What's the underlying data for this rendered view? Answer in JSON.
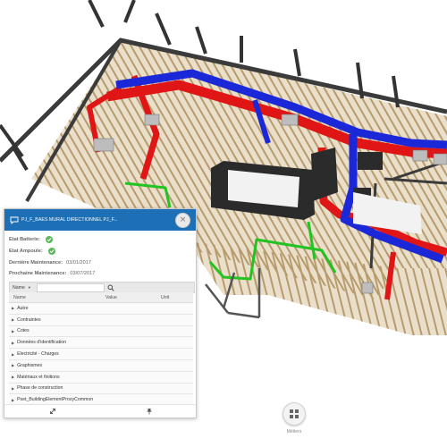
{
  "panel": {
    "title": "PJ_F_BAES MURAL DIRECTIONNEL PJ_F...",
    "rows": [
      {
        "label": "Etat Batterie:",
        "type": "check"
      },
      {
        "label": "Etat Ampoule:",
        "type": "check"
      },
      {
        "label": "Dernière Maintenance:",
        "value": "03/01/2017"
      },
      {
        "label": "Prochaine Maintenance:",
        "value": "03/07/2017"
      }
    ],
    "filter": {
      "select_label": "Name"
    },
    "columns": {
      "name": "Name",
      "value": "Value",
      "unit": "Unit"
    },
    "groups": [
      "Autre",
      "Contraintes",
      "Cotes",
      "Données d'identification",
      "Electricité - Charges",
      "Graphismes",
      "Matériaux et finitions",
      "Phase de construction",
      "Pset_BuildingElementProxyCommon"
    ]
  },
  "metiers": {
    "label": "Métiers"
  },
  "colors": {
    "header": "#1d6fb6",
    "check": "#5cb85c",
    "duct_red": "#e01515",
    "duct_blue": "#1a28d8",
    "pipe_green": "#22c422",
    "beam": "#c9b28a"
  },
  "icons": [
    "chat-icon",
    "close-icon",
    "check-icon",
    "search-icon",
    "caret-right-icon",
    "expand-icon",
    "pin-icon",
    "grid-icon"
  ]
}
